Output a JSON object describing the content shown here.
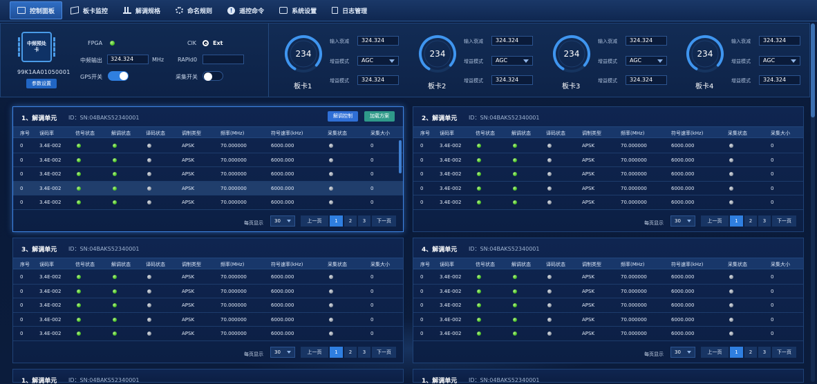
{
  "nav": {
    "items": [
      {
        "label": "控制面板",
        "icon": "monitor-icon",
        "active": true
      },
      {
        "label": "板卡监控",
        "icon": "card-icon"
      },
      {
        "label": "解调规格",
        "icon": "spectrum-icon"
      },
      {
        "label": "命名规则",
        "icon": "gear-icon"
      },
      {
        "label": "遥控命令",
        "icon": "alert-icon"
      },
      {
        "label": "系统设置",
        "icon": "settings-icon"
      },
      {
        "label": "日志管理",
        "icon": "log-icon"
      }
    ]
  },
  "device": {
    "chip_label": "中频预处卡",
    "id": "99K1AA01050001",
    "param_button": "参数设置",
    "fpga_label": "FPGA",
    "fpga_status": "green",
    "if_output_label": "中频输出",
    "if_output_value": "324.324",
    "if_output_unit": "MHz",
    "gps_label": "GPS开关",
    "gps_on": true,
    "clk_label": "ClK",
    "clk_value": "Ext",
    "rapid_label": "RAPId0",
    "rapid_value": "",
    "collect_label": "采集开关",
    "collect_on": false
  },
  "cards": [
    {
      "name": "板卡1",
      "gauge": "234",
      "gauge_fraction": 0.78,
      "atten_label": "输入衰减",
      "atten": "324.324",
      "gain_label": "增益模式",
      "gain_mode": "AGC",
      "gain2_label": "增益模式",
      "gain2": "324.324"
    },
    {
      "name": "板卡2",
      "gauge": "234",
      "gauge_fraction": 0.78,
      "atten_label": "输入衰减",
      "atten": "324.324",
      "gain_label": "增益模式",
      "gain_mode": "AGC",
      "gain2_label": "增益模式",
      "gain2": "324.324"
    },
    {
      "name": "板卡3",
      "gauge": "234",
      "gauge_fraction": 0.78,
      "atten_label": "输入衰减",
      "atten": "324.324",
      "gain_label": "增益模式",
      "gain_mode": "AGC",
      "gain2_label": "增益模式",
      "gain2": "324.324"
    },
    {
      "name": "板卡4",
      "gauge": "234",
      "gauge_fraction": 0.78,
      "atten_label": "输入衰减",
      "atten": "324.324",
      "gain_label": "增益模式",
      "gain_mode": "AGC",
      "gain2_label": "增益模式",
      "gain2": "324.324"
    }
  ],
  "table_headers": [
    "序号",
    "误码率",
    "信号状态",
    "解调状态",
    "译码状态",
    "调制类型",
    "频率(MHz)",
    "符号速率(kHz)",
    "采集状态",
    "采集大小"
  ],
  "pager": {
    "per_page_label": "每页显示",
    "per_page": "30",
    "prev": "上一页",
    "pages": [
      "1",
      "2",
      "3"
    ],
    "next": "下一页"
  },
  "colors": {
    "accent": "#2f7fe0",
    "led_green": "#4dc22a",
    "led_gray": "#9aa2ad"
  },
  "panels": [
    {
      "title": "1、解调单元",
      "id": "ID：SN:04BAKS52340001",
      "selected": true,
      "btn_control": "解调控制",
      "btn_load": "加载方案",
      "rows": [
        {
          "no": "0",
          "ber": "3.4E-002",
          "mod": "APSK",
          "freq": "70.000000",
          "rate": "6000.000",
          "size": "0"
        },
        {
          "no": "0",
          "ber": "3.4E-002",
          "mod": "APSK",
          "freq": "70.000000",
          "rate": "6000.000",
          "size": "0"
        },
        {
          "no": "0",
          "ber": "3.4E-002",
          "mod": "APSK",
          "freq": "70.000000",
          "rate": "6000.000",
          "size": "0"
        },
        {
          "no": "0",
          "ber": "3.4E-002",
          "mod": "APSK",
          "freq": "70.000000",
          "rate": "6000.000",
          "size": "0",
          "hl": true
        },
        {
          "no": "0",
          "ber": "3.4E-002",
          "mod": "APSK",
          "freq": "70.000000",
          "rate": "6000.000",
          "size": "0"
        }
      ]
    },
    {
      "title": "2、解调单元",
      "id": "ID：SN:04BAKS52340001",
      "rows": [
        {
          "no": "0",
          "ber": "3.4E-002",
          "mod": "APSK",
          "freq": "70.000000",
          "rate": "6000.000",
          "size": "0"
        },
        {
          "no": "0",
          "ber": "3.4E-002",
          "mod": "APSK",
          "freq": "70.000000",
          "rate": "6000.000",
          "size": "0"
        },
        {
          "no": "0",
          "ber": "3.4E-002",
          "mod": "APSK",
          "freq": "70.000000",
          "rate": "6000.000",
          "size": "0"
        },
        {
          "no": "0",
          "ber": "3.4E-002",
          "mod": "APSK",
          "freq": "70.000000",
          "rate": "6000.000",
          "size": "0"
        },
        {
          "no": "0",
          "ber": "3.4E-002",
          "mod": "APSK",
          "freq": "70.000000",
          "rate": "6000.000",
          "size": "0"
        }
      ]
    },
    {
      "title": "3、解调单元",
      "id": "ID：SN:04BAKS52340001",
      "rows": [
        {
          "no": "0",
          "ber": "3.4E-002",
          "mod": "APSK",
          "freq": "70.000000",
          "rate": "6000.000",
          "size": "0"
        },
        {
          "no": "0",
          "ber": "3.4E-002",
          "mod": "APSK",
          "freq": "70.000000",
          "rate": "6000.000",
          "size": "0"
        },
        {
          "no": "0",
          "ber": "3.4E-002",
          "mod": "APSK",
          "freq": "70.000000",
          "rate": "6000.000",
          "size": "0"
        },
        {
          "no": "0",
          "ber": "3.4E-002",
          "mod": "APSK",
          "freq": "70.000000",
          "rate": "6000.000",
          "size": "0"
        },
        {
          "no": "0",
          "ber": "3.4E-002",
          "mod": "APSK",
          "freq": "70.000000",
          "rate": "6000.000",
          "size": "0"
        }
      ]
    },
    {
      "title": "4、解调单元",
      "id": "ID：SN:04BAKS52340001",
      "rows": [
        {
          "no": "0",
          "ber": "3.4E-002",
          "mod": "APSK",
          "freq": "70.000000",
          "rate": "6000.000",
          "size": "0"
        },
        {
          "no": "0",
          "ber": "3.4E-002",
          "mod": "APSK",
          "freq": "70.000000",
          "rate": "6000.000",
          "size": "0"
        },
        {
          "no": "0",
          "ber": "3.4E-002",
          "mod": "APSK",
          "freq": "70.000000",
          "rate": "6000.000",
          "size": "0"
        },
        {
          "no": "0",
          "ber": "3.4E-002",
          "mod": "APSK",
          "freq": "70.000000",
          "rate": "6000.000",
          "size": "0"
        },
        {
          "no": "0",
          "ber": "3.4E-002",
          "mod": "APSK",
          "freq": "70.000000",
          "rate": "6000.000",
          "size": "0"
        }
      ]
    }
  ],
  "bottom_strips": [
    {
      "title": "1、解调单元",
      "id": "ID：SN:04BAKS52340001"
    },
    {
      "title": "1、解调单元",
      "id": "ID：SN:04BAKS52340001"
    }
  ]
}
